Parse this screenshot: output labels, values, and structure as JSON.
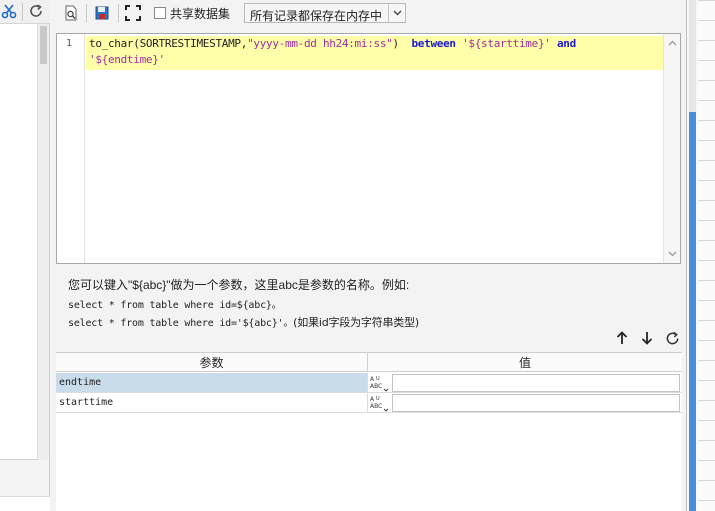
{
  "toolbar": {
    "share_dataset_label": "共享数据集",
    "share_dataset_checked": false,
    "storage_select_value": "所有记录都保存在内存中"
  },
  "editor": {
    "line_number": "1",
    "line1": {
      "fn": "to_char(SORTRESTIMESTAMP,",
      "fmt": "\"yyyy-mm-dd hh24:mi:ss\"",
      "close": ")",
      "kw_between": "between",
      "arg1": "'${starttime}'",
      "kw_and": "and"
    },
    "line2": {
      "arg2": "'${endtime}'"
    }
  },
  "hint": {
    "line1": "您可以键入\"${abc}\"做为一个参数，这里abc是参数的名称。例如:",
    "line2": "select * from table where id=${abc}。",
    "line3_code": "select * from table where id='${abc}'。",
    "line3_note": "(如果id字段为字符串类型)"
  },
  "param_table": {
    "headers": [
      "参数",
      "值"
    ],
    "rows": [
      {
        "name": "endtime",
        "value": "",
        "selected": true
      },
      {
        "name": "starttime",
        "value": "",
        "selected": false
      }
    ]
  },
  "colors": {
    "selection": "#c9dcea",
    "current_line": "#ffffaa",
    "keyword": "#1a1ad0",
    "string": "#a02ca0",
    "scroll_thumb": "#4a8fd4"
  }
}
